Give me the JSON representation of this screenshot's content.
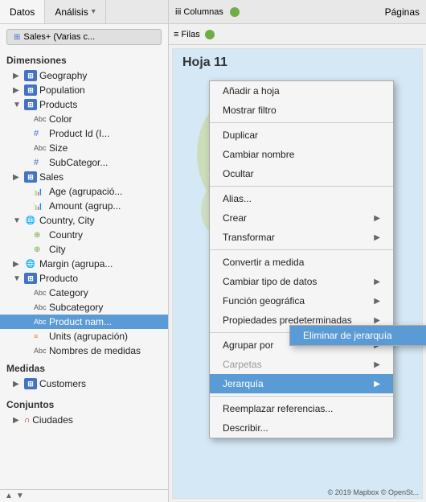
{
  "tabs": {
    "datos": "Datos",
    "analisis": "Análisis",
    "paginas": "Páginas"
  },
  "filter_badge": "Sales+ (Varias c...",
  "sections": {
    "dimensiones": "Dimensiones",
    "medidas": "Medidas",
    "conjuntos": "Conjuntos"
  },
  "tree": {
    "geography": "Geography",
    "population": "Population",
    "products": "Products",
    "color": "Color",
    "product_id": "Product Id (I...",
    "size": "Size",
    "subcategory": "SubCategor...",
    "sales": "Sales",
    "age": "Age (agrupació...",
    "amount": "Amount (agrup...",
    "country_city": "Country, City",
    "country": "Country",
    "city": "City",
    "margin": "Margin (agrupa...",
    "producto": "Producto",
    "category": "Category",
    "subcategory2": "Subcategory",
    "product_name": "Product nam...",
    "units": "Units (agrupación)",
    "nombres": "Nombres de medidas",
    "customers": "Customers",
    "ciudades": "Ciudades"
  },
  "context_menu": {
    "añadir": "Añadir a hoja",
    "mostrar": "Mostrar filtro",
    "duplicar": "Duplicar",
    "cambiar_nombre": "Cambiar nombre",
    "ocultar": "Ocultar",
    "alias": "Alias...",
    "crear": "Crear",
    "transformar": "Transformar",
    "convertir": "Convertir a medida",
    "cambiar_tipo": "Cambiar tipo de datos",
    "funcion_geo": "Función geográfica",
    "propiedades": "Propiedades predeterminadas",
    "agrupar": "Agrupar por",
    "carpetas": "Carpetas",
    "jerarquia": "Jerarquía",
    "reemplazar": "Reemplazar referencias...",
    "describir": "Describir..."
  },
  "submenu": {
    "eliminar": "Eliminar de jerarquía"
  },
  "shelf": {
    "columnas_label": "iii Columnas",
    "filas_label": "≡ Filas"
  },
  "sheet": {
    "title": "Hoja 11"
  },
  "map_attribution": "© 2019 Mapbox © OpenSt..."
}
